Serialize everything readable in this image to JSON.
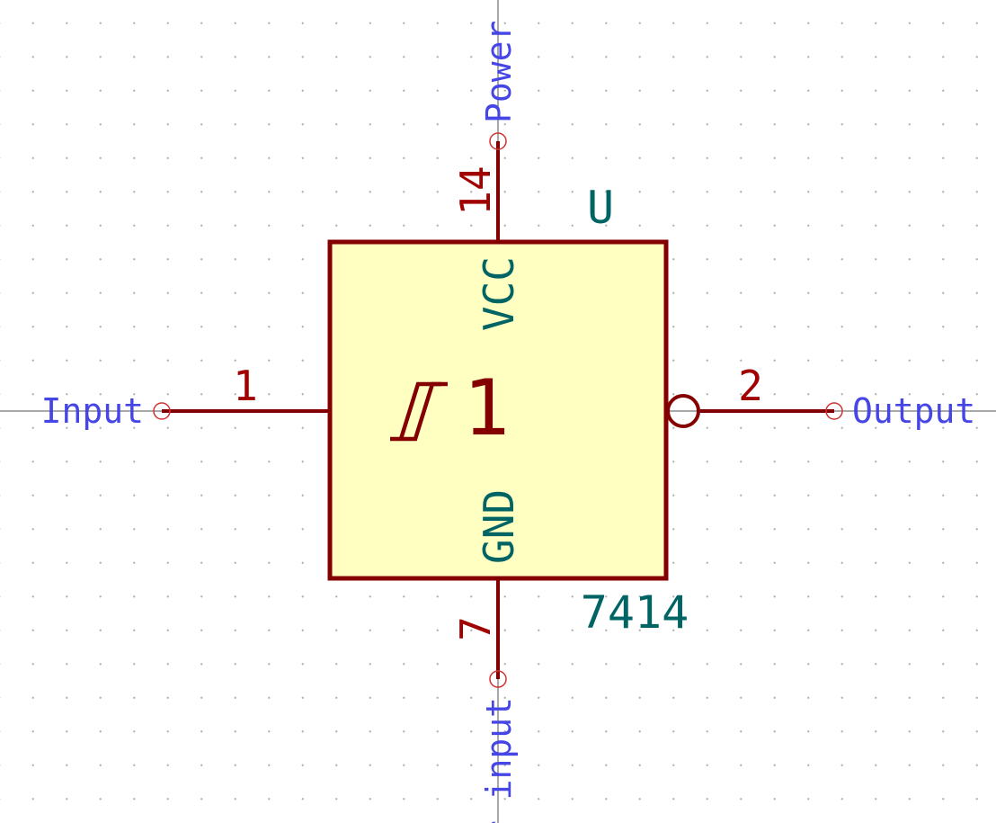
{
  "symbol": {
    "reference": "U",
    "value": "7414",
    "unit_text": "1",
    "body_fill": "#ffffc2",
    "outline_color": "#840000",
    "field_color": "#006464",
    "pin_num_color": "#a00000",
    "pin_type_color": "#4646e6"
  },
  "pins": {
    "input": {
      "number": "1",
      "type": "Input"
    },
    "output": {
      "number": "2",
      "type": "Output"
    },
    "vcc": {
      "number": "14",
      "name": "VCC",
      "type": "Power"
    },
    "gnd": {
      "number": "7",
      "name": "GND",
      "type": "r input"
    }
  }
}
